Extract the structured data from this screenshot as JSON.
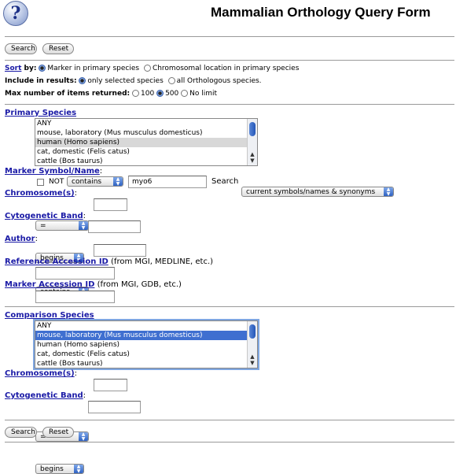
{
  "header": {
    "help_icon": "?",
    "title": "Mammalian Orthology Query Form"
  },
  "buttons": {
    "search": "Search",
    "reset": "Reset"
  },
  "sort": {
    "label": "Sort",
    "by": " by:",
    "options": [
      "Marker in primary species",
      "Chromosomal location in primary species"
    ],
    "selected": "Marker in primary species"
  },
  "include": {
    "label": "Include in results:",
    "options": [
      "only selected species",
      "all Orthologous species."
    ],
    "selected": "only selected species"
  },
  "max_items": {
    "label": "Max number of items returned:",
    "options": [
      "100",
      "500",
      "No limit"
    ],
    "selected": "500"
  },
  "primary": {
    "label": "Primary Species",
    "species": [
      "ANY",
      "mouse, laboratory (Mus musculus domesticus)",
      "human (Homo sapiens)",
      "cat, domestic (Felis catus)",
      "cattle (Bos taurus)"
    ],
    "selected": "human (Homo sapiens)",
    "marker_label": "Marker Symbol/Name",
    "colon": ":",
    "not_label": "NOT",
    "marker_op": "contains",
    "marker_value": "myo6",
    "search_label": "Search",
    "search_scope": "current symbols/names & synonyms",
    "chromosome_label": "Chromosome(s)",
    "chromosome_op": "=",
    "cyto_label": "Cytogenetic Band",
    "cyto_op": "begins",
    "author_label": "Author",
    "author_op": "contains",
    "ref_label": "Reference Accession ID",
    "ref_note": " (from MGI, MEDLINE, etc.)",
    "marker_acc_label": "Marker Accession ID",
    "marker_acc_note": " (from MGI, GDB, etc.)"
  },
  "comparison": {
    "label": "Comparison Species",
    "species": [
      "ANY",
      "mouse, laboratory (Mus musculus domesticus)",
      "human (Homo sapiens)",
      "cat, domestic (Felis catus)",
      "cattle (Bos taurus)"
    ],
    "selected": "mouse, laboratory (Mus musculus domesticus)",
    "chromosome_label": "Chromosome(s)",
    "chromosome_op": "=",
    "cyto_label": "Cytogenetic Band",
    "cyto_op": "begins"
  }
}
